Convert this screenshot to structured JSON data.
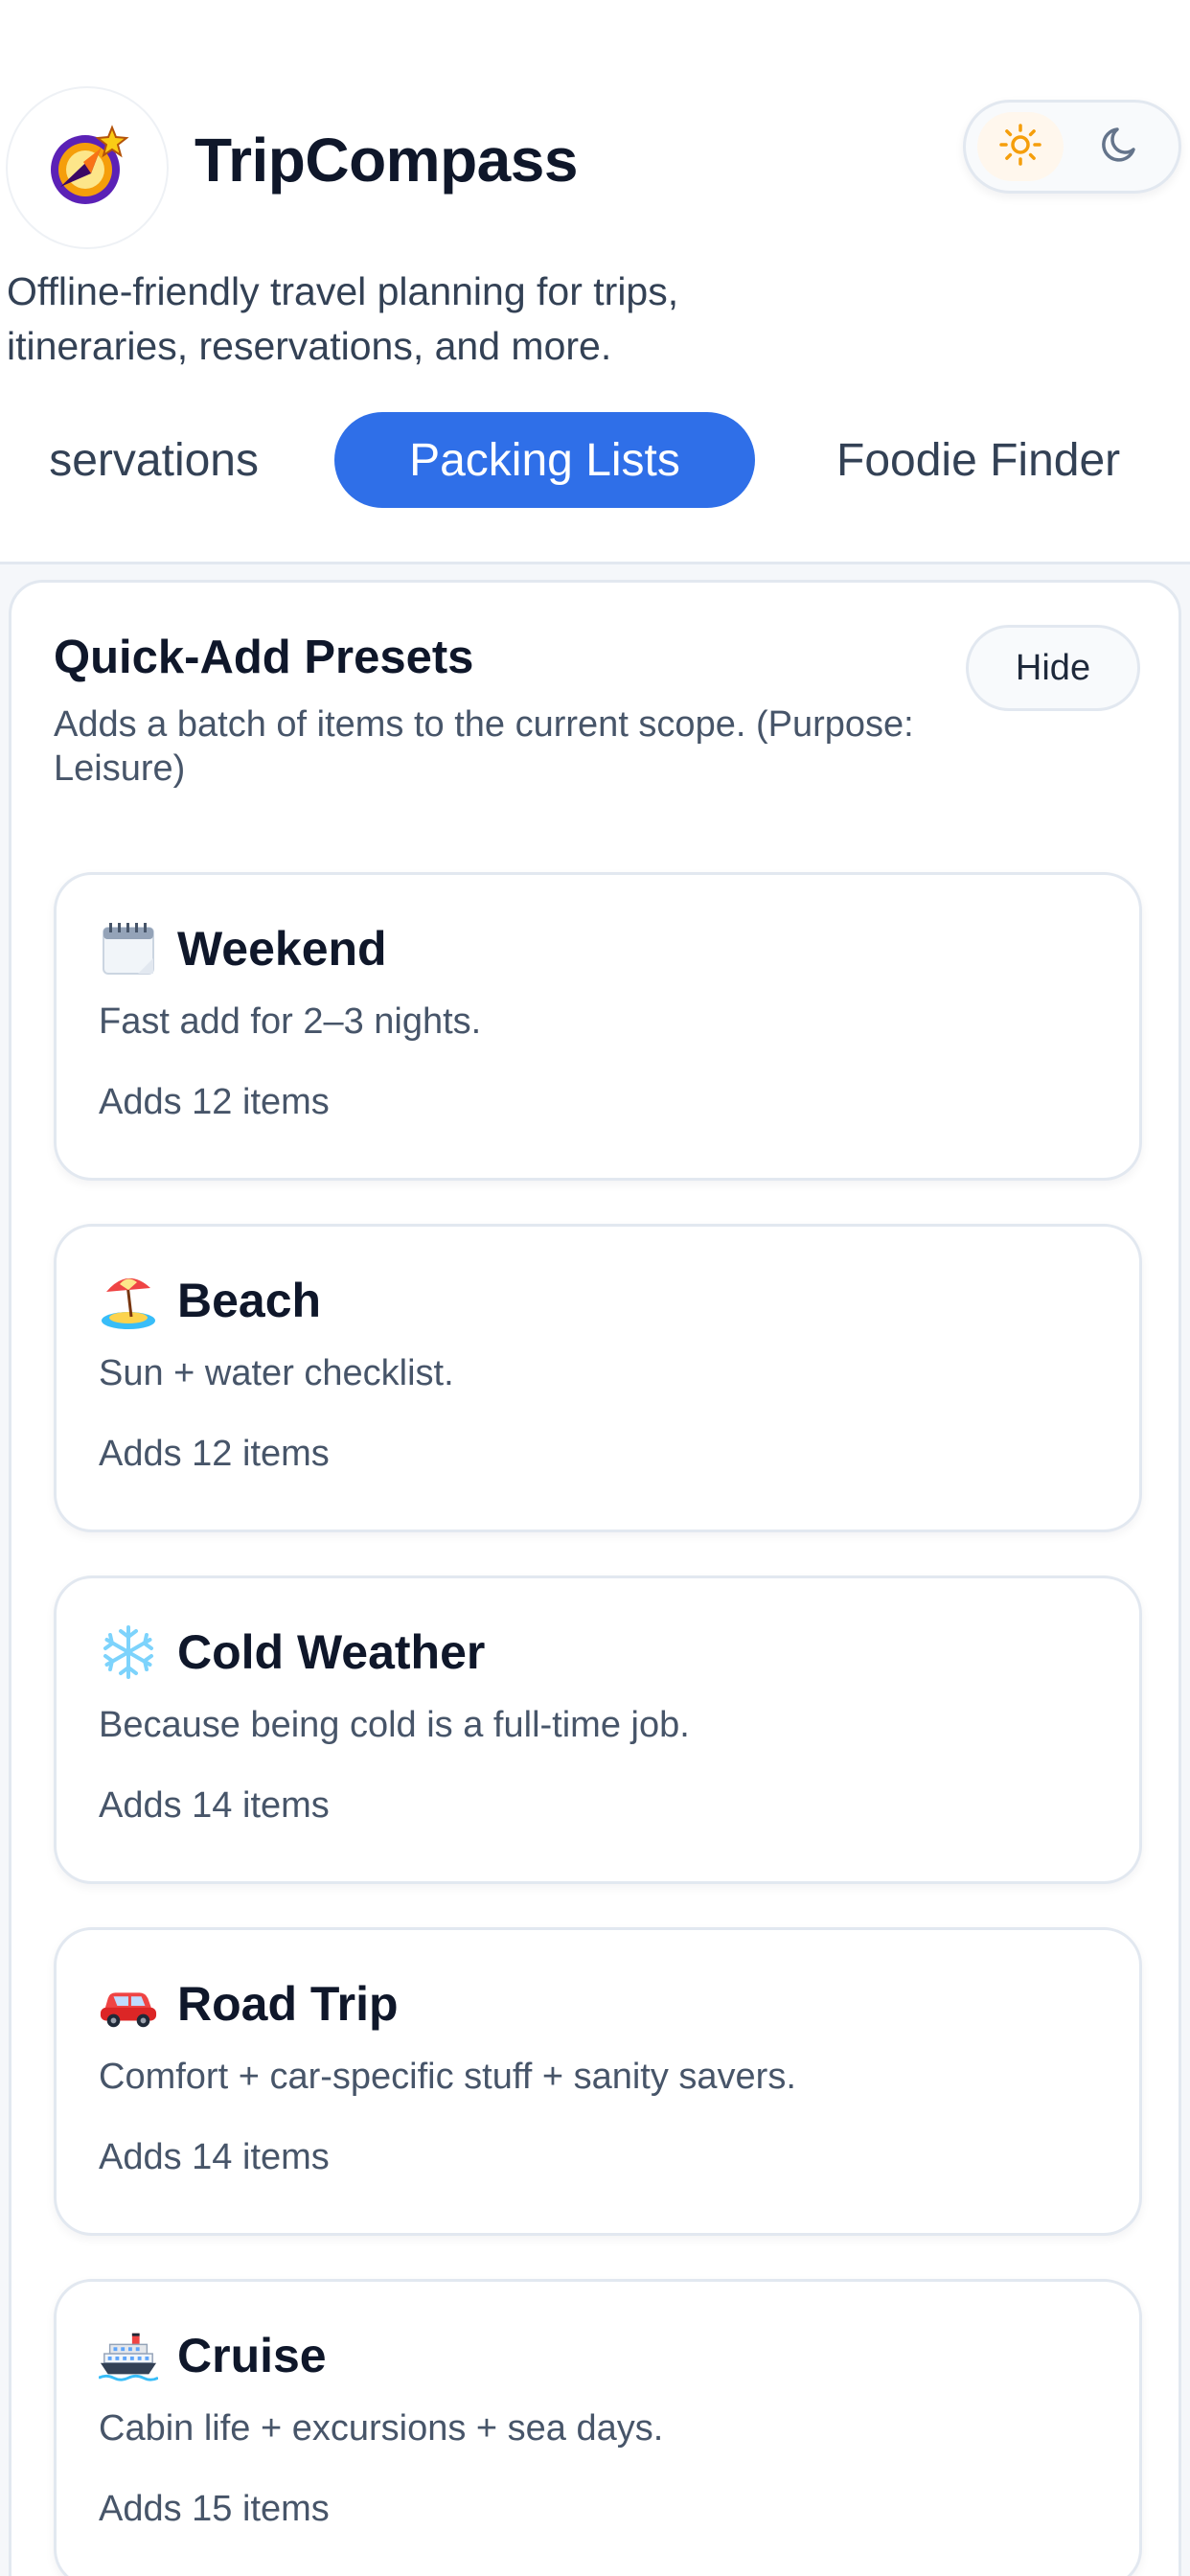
{
  "app": {
    "title": "TripCompass",
    "tagline": "Offline-friendly travel planning for trips, itineraries, reservations, and more.",
    "logo_icon": "compass-star-logo"
  },
  "theme_toggle": {
    "light_icon": "sun-icon",
    "dark_icon": "moon-icon",
    "active": "light",
    "active_color": "#f59e0b"
  },
  "tabs": [
    {
      "label": "Reservations",
      "visible_label": "servations",
      "active": false
    },
    {
      "label": "Packing Lists",
      "active": true
    },
    {
      "label": "Foodie Finder",
      "active": false
    }
  ],
  "presets_panel": {
    "title": "Quick-Add Presets",
    "description": "Adds a batch of items to the current scope. (Purpose: Leisure)",
    "hide_label": "Hide"
  },
  "presets": [
    {
      "icon": "calendar-icon",
      "name": "Weekend",
      "description": "Fast add for 2–3 nights.",
      "count_text": "Adds 12 items"
    },
    {
      "icon": "beach-umbrella-icon",
      "name": "Beach",
      "description": "Sun + water checklist.",
      "count_text": "Adds 12 items"
    },
    {
      "icon": "snowflake-icon",
      "name": "Cold Weather",
      "description": "Because being cold is a full-time job.",
      "count_text": "Adds 14 items"
    },
    {
      "icon": "car-icon",
      "name": "Road Trip",
      "description": "Comfort + car-specific stuff + sanity savers.",
      "count_text": "Adds 14 items"
    },
    {
      "icon": "ship-icon",
      "name": "Cruise",
      "description": "Cabin life + excursions + sea days.",
      "count_text": "Adds 15 items"
    }
  ],
  "colors": {
    "accent": "#2f6fe8",
    "text_primary": "#0f172a",
    "text_secondary": "#475569",
    "border": "#e2e8f0"
  }
}
